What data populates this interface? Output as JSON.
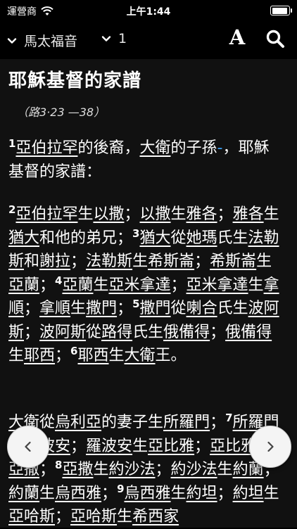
{
  "status": {
    "carrier": "運營商",
    "time": "上午1:44",
    "battery_level": 0.95
  },
  "toolbar": {
    "book": "馬太福音",
    "chapter": "1",
    "font_label": "A"
  },
  "content": {
    "title": "耶穌基督的家譜",
    "reference": "（路3·23 —38）",
    "p1": [
      {
        "t": "1",
        "k": "v"
      },
      {
        "t": "亞伯拉罕",
        "k": "u"
      },
      {
        "t": "的後裔，",
        "k": "n"
      },
      {
        "t": "大衛",
        "k": "u"
      },
      {
        "t": "的子孫",
        "k": "n"
      },
      {
        "t": "-",
        "k": "d"
      },
      {
        "t": "，耶穌基督的家譜：",
        "k": "n"
      }
    ],
    "p2": [
      {
        "t": "2",
        "k": "v"
      },
      {
        "t": "亞伯拉罕",
        "k": "u"
      },
      {
        "t": "生",
        "k": "n"
      },
      {
        "t": "以撒",
        "k": "u"
      },
      {
        "t": "；",
        "k": "n"
      },
      {
        "t": "以撒",
        "k": "u"
      },
      {
        "t": "生",
        "k": "n"
      },
      {
        "t": "雅各",
        "k": "u"
      },
      {
        "t": "；",
        "k": "n"
      },
      {
        "t": "雅各",
        "k": "u"
      },
      {
        "t": "生",
        "k": "n"
      },
      {
        "t": "猶大",
        "k": "u"
      },
      {
        "t": "和他的弟兄；",
        "k": "n"
      },
      {
        "t": "3",
        "k": "v"
      },
      {
        "t": "猶大",
        "k": "u"
      },
      {
        "t": "從",
        "k": "n"
      },
      {
        "t": "她瑪",
        "k": "u"
      },
      {
        "t": "氏生",
        "k": "n"
      },
      {
        "t": "法勒斯",
        "k": "u"
      },
      {
        "t": "和",
        "k": "n"
      },
      {
        "t": "謝拉",
        "k": "u"
      },
      {
        "t": "；",
        "k": "n"
      },
      {
        "t": "法勒斯",
        "k": "u"
      },
      {
        "t": "生",
        "k": "n"
      },
      {
        "t": "希斯崙",
        "k": "u"
      },
      {
        "t": "；",
        "k": "n"
      },
      {
        "t": "希斯崙",
        "k": "u"
      },
      {
        "t": "生",
        "k": "n"
      },
      {
        "t": "亞蘭",
        "k": "u"
      },
      {
        "t": "；",
        "k": "n"
      },
      {
        "t": "4",
        "k": "v"
      },
      {
        "t": "亞蘭",
        "k": "u"
      },
      {
        "t": "生",
        "k": "n"
      },
      {
        "t": "亞米拿達",
        "k": "u"
      },
      {
        "t": "；",
        "k": "n"
      },
      {
        "t": "亞米拿達",
        "k": "u"
      },
      {
        "t": "生",
        "k": "n"
      },
      {
        "t": "拿順",
        "k": "u"
      },
      {
        "t": "；",
        "k": "n"
      },
      {
        "t": "拿順",
        "k": "u"
      },
      {
        "t": "生",
        "k": "n"
      },
      {
        "t": "撒門",
        "k": "u"
      },
      {
        "t": "；",
        "k": "n"
      },
      {
        "t": "5",
        "k": "v"
      },
      {
        "t": "撒門",
        "k": "u"
      },
      {
        "t": "從",
        "k": "n"
      },
      {
        "t": "喇合",
        "k": "u"
      },
      {
        "t": "氏生",
        "k": "n"
      },
      {
        "t": "波阿斯",
        "k": "u"
      },
      {
        "t": "；",
        "k": "n"
      },
      {
        "t": "波阿斯",
        "k": "u"
      },
      {
        "t": "從",
        "k": "n"
      },
      {
        "t": "路得",
        "k": "u"
      },
      {
        "t": "氏生",
        "k": "n"
      },
      {
        "t": "俄備得",
        "k": "u"
      },
      {
        "t": "；",
        "k": "n"
      },
      {
        "t": "俄備得",
        "k": "u"
      },
      {
        "t": "生",
        "k": "n"
      },
      {
        "t": "耶西",
        "k": "u"
      },
      {
        "t": "；",
        "k": "n"
      },
      {
        "t": "6",
        "k": "v"
      },
      {
        "t": "耶西",
        "k": "u"
      },
      {
        "t": "生",
        "k": "n"
      },
      {
        "t": "大衛",
        "k": "u"
      },
      {
        "t": "王。",
        "k": "n"
      }
    ],
    "p3": [
      {
        "t": "大衛",
        "k": "u"
      },
      {
        "t": "從",
        "k": "n"
      },
      {
        "t": "烏利亞",
        "k": "u"
      },
      {
        "t": "的妻子生",
        "k": "n"
      },
      {
        "t": "所羅門",
        "k": "u"
      },
      {
        "t": "；",
        "k": "n"
      },
      {
        "t": "7",
        "k": "v"
      },
      {
        "t": "所羅門",
        "k": "u"
      },
      {
        "t": "生",
        "k": "n"
      },
      {
        "t": "羅波安",
        "k": "u"
      },
      {
        "t": "；",
        "k": "n"
      },
      {
        "t": "羅波安",
        "k": "u"
      },
      {
        "t": "生",
        "k": "n"
      },
      {
        "t": "亞比雅",
        "k": "u"
      },
      {
        "t": "；",
        "k": "n"
      },
      {
        "t": "亞比雅",
        "k": "u"
      },
      {
        "t": "生",
        "k": "n"
      },
      {
        "t": "亞撒",
        "k": "u"
      },
      {
        "t": "；",
        "k": "n"
      },
      {
        "t": "8",
        "k": "v"
      },
      {
        "t": "亞撒",
        "k": "u"
      },
      {
        "t": "生",
        "k": "n"
      },
      {
        "t": "約沙法",
        "k": "u"
      },
      {
        "t": "；",
        "k": "n"
      },
      {
        "t": "約沙法",
        "k": "u"
      },
      {
        "t": "生",
        "k": "n"
      },
      {
        "t": "約蘭",
        "k": "u"
      },
      {
        "t": "；",
        "k": "n"
      },
      {
        "t": "約蘭",
        "k": "u"
      },
      {
        "t": "生",
        "k": "n"
      },
      {
        "t": "烏西雅",
        "k": "u"
      },
      {
        "t": "；",
        "k": "n"
      },
      {
        "t": "9",
        "k": "v"
      },
      {
        "t": "烏西雅",
        "k": "u"
      },
      {
        "t": "生",
        "k": "n"
      },
      {
        "t": "約坦",
        "k": "u"
      },
      {
        "t": "；",
        "k": "n"
      },
      {
        "t": "約坦",
        "k": "u"
      },
      {
        "t": "生",
        "k": "n"
      },
      {
        "t": "亞哈斯",
        "k": "u"
      },
      {
        "t": "；",
        "k": "n"
      },
      {
        "t": "亞哈斯",
        "k": "u"
      },
      {
        "t": "生",
        "k": "n"
      },
      {
        "t": "希西家",
        "k": "u"
      }
    ]
  },
  "icons": {
    "wifi": "wifi-icon",
    "battery": "battery-icon",
    "book_chevron": "chevron-down-icon",
    "search": "search-icon",
    "prev": "chevron-left-icon",
    "next": "chevron-right-icon"
  },
  "colors": {
    "background": "#000000",
    "reader_background": "#111111",
    "text": "#ffffff",
    "accent": "#3a9df0",
    "nav_button": "#f4f4f4"
  }
}
